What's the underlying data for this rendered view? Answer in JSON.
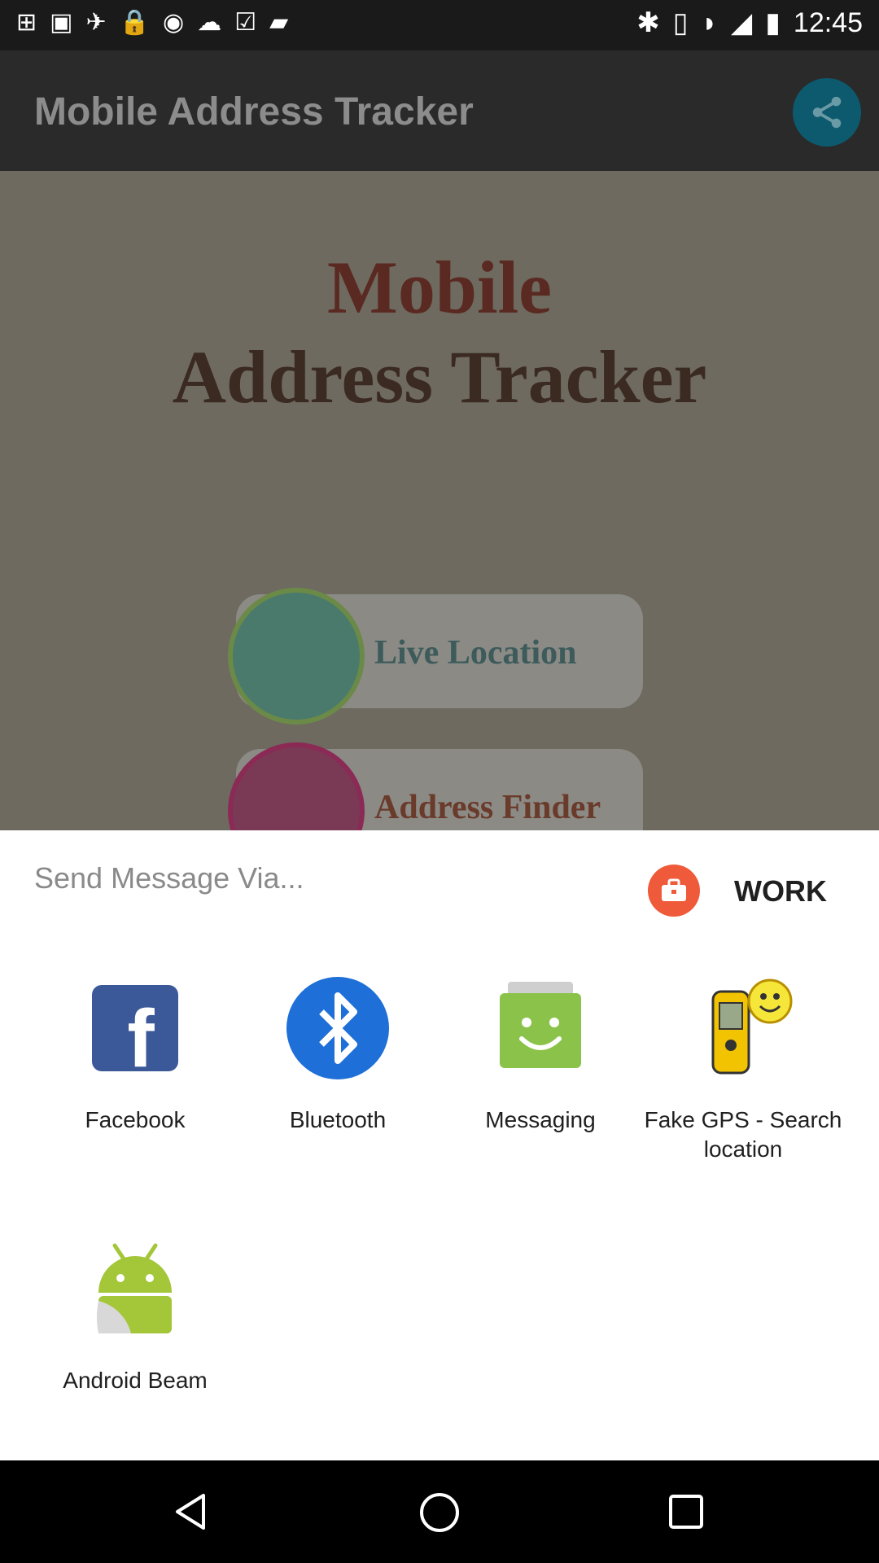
{
  "status_bar": {
    "time": "12:45",
    "notification_icons": [
      "app-icon",
      "image-icon",
      "satellite-icon",
      "lock-icon",
      "message-icon",
      "cloud-icon",
      "check-icon",
      "folder-icon"
    ],
    "system_icons": [
      "bluetooth-icon",
      "vibrate-icon",
      "wifi-icon",
      "signal-icon",
      "battery-icon"
    ]
  },
  "app_bar": {
    "title": "Mobile Address Tracker"
  },
  "content": {
    "logo_line1": "Mobile",
    "logo_line2": "Address Tracker",
    "buttons": [
      {
        "label": "Live Location"
      },
      {
        "label": "Address Finder"
      }
    ]
  },
  "share_sheet": {
    "title": "Send Message Via...",
    "work_label": "WORK",
    "apps": [
      {
        "label": "Facebook"
      },
      {
        "label": "Bluetooth"
      },
      {
        "label": "Messaging"
      },
      {
        "label": "Fake GPS - Search location"
      },
      {
        "label": "Android Beam"
      }
    ]
  },
  "colors": {
    "facebook": "#3b5998",
    "bluetooth": "#1e6fd8",
    "messaging": "#8bc34a",
    "android": "#a4c639",
    "work": "#ee5a3a"
  }
}
